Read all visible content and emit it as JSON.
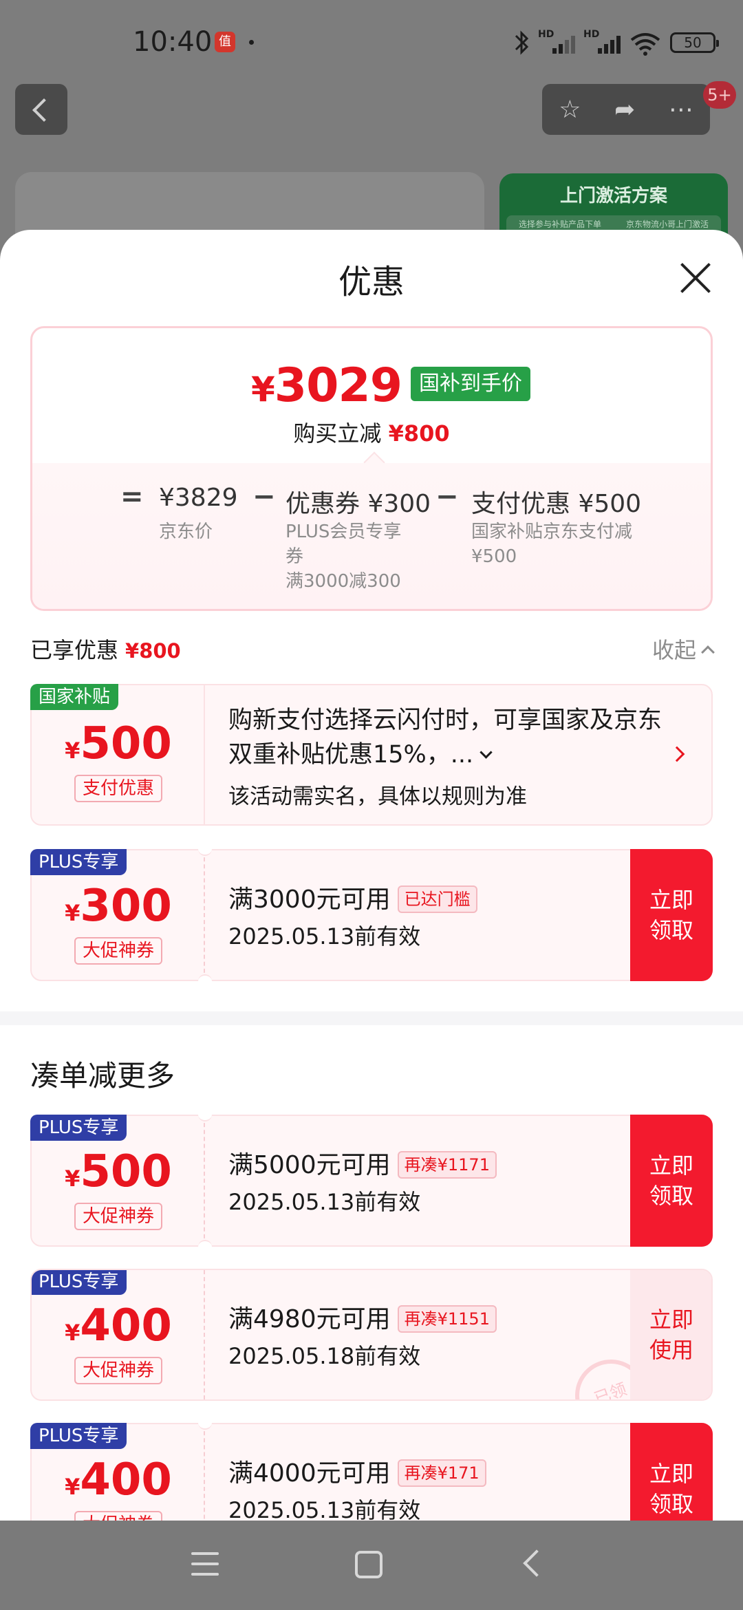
{
  "status_bar": {
    "time": "10:40",
    "app_icon": "值",
    "battery": "50"
  },
  "header": {
    "badge": "5+",
    "green_card_title": "上门激活方案",
    "green_card_steps": [
      "选择参与补贴产品下单",
      "京东物流小哥上门激活"
    ]
  },
  "sheet": {
    "title": "优惠",
    "price": {
      "final": "3029",
      "currency": "¥",
      "tag": "国补到手价",
      "reduce_label": "购买立减",
      "reduce_amount": "¥800",
      "eq": "=",
      "op_minus": "−",
      "items": [
        {
          "value": "¥3829",
          "label": "京东价"
        },
        {
          "value": "优惠券 ¥300",
          "label": "PLUS会员专享券",
          "label2": "满3000减300"
        },
        {
          "value": "支付优惠 ¥500",
          "label": "国家补贴京东支付减¥500"
        }
      ]
    },
    "enjoyed": {
      "label": "已享优惠",
      "amount": "¥800",
      "collapse": "收起"
    },
    "subsidy": {
      "ribbon": "国家补贴",
      "amount": "500",
      "currency": "¥",
      "type": "支付优惠",
      "desc": "购新支付选择云闪付时，可享国家及京东双重补贴优惠15%，...",
      "note": "该活动需实名，具体以规则为准"
    },
    "coupons": [
      {
        "ribbon": "PLUS专享",
        "amount": "300",
        "currency": "¥",
        "type": "大促神券",
        "condition": "满3000元可用",
        "pill": "已达门槛",
        "date": "2025.05.13前有效",
        "cta": "立即领取"
      }
    ],
    "more_section_title": "凑单减更多",
    "more_coupons": [
      {
        "ribbon": "PLUS专享",
        "amount": "500",
        "currency": "¥",
        "type": "大促神券",
        "condition": "满5000元可用",
        "pill": "再凑¥1171",
        "date": "2025.05.13前有效",
        "cta": "立即领取"
      },
      {
        "ribbon": "PLUS专享",
        "amount": "400",
        "currency": "¥",
        "type": "大促神券",
        "condition": "满4980元可用",
        "pill": "再凑¥1151",
        "date": "2025.05.18前有效",
        "cta": "立即使用",
        "stamp": "已领"
      },
      {
        "ribbon": "PLUS专享",
        "amount": "400",
        "currency": "¥",
        "type": "大促神券",
        "condition": "满4000元可用",
        "pill": "再凑¥171",
        "date": "2025.05.13前有效",
        "cta": "立即领取"
      }
    ]
  },
  "colors": {
    "accent_red": "#e8151f",
    "cta_red": "#f31a2e",
    "green_tag": "#27a047",
    "plus_blue": "#2f3ea6"
  }
}
